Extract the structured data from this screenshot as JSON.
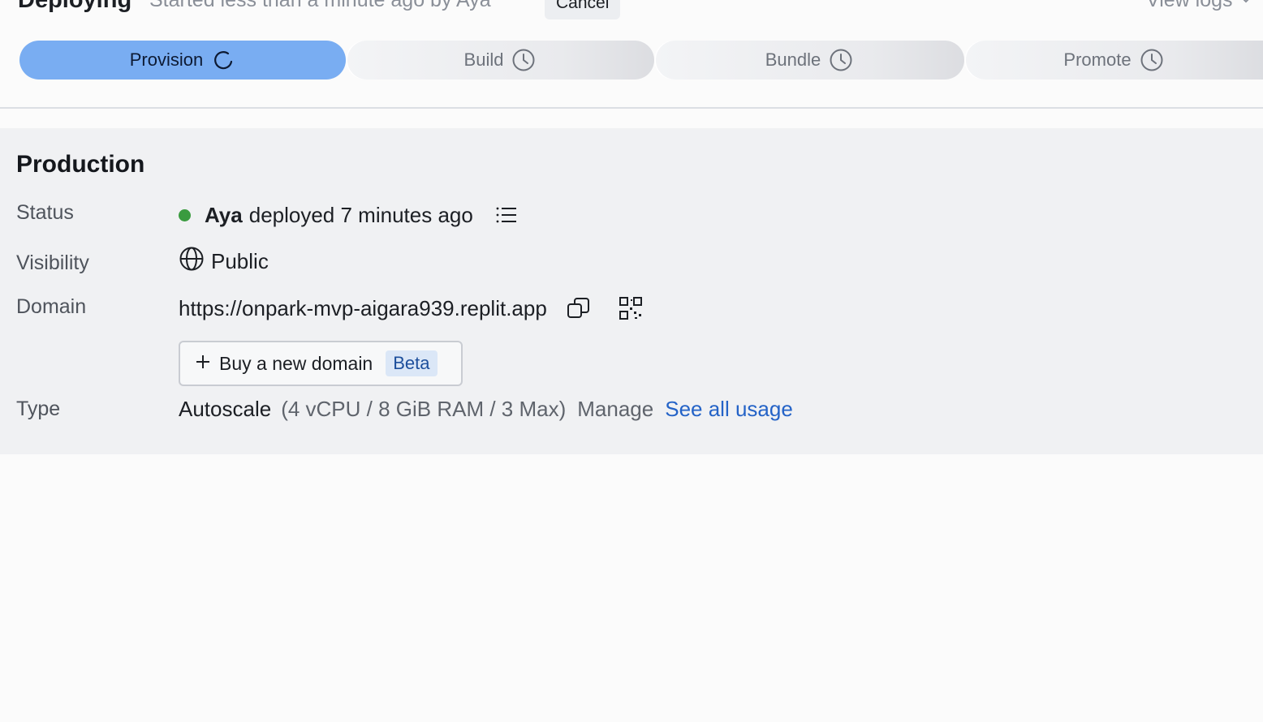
{
  "header": {
    "title": "Deploying",
    "subtitle": "Started less than a minute ago by Aya",
    "cancel_label": "Cancel",
    "view_logs_label": "View logs"
  },
  "steps": [
    {
      "label": "Provision",
      "state": "active",
      "icon": "spinner-icon"
    },
    {
      "label": "Build",
      "state": "pending",
      "icon": "clock-icon"
    },
    {
      "label": "Bundle",
      "state": "pending",
      "icon": "clock-icon"
    },
    {
      "label": "Promote",
      "state": "pending",
      "icon": "clock-icon"
    }
  ],
  "production": {
    "title": "Production",
    "status": {
      "label": "Status",
      "user": "Aya",
      "text": "deployed 7 minutes ago",
      "indicator_color": "#3a9b3f"
    },
    "visibility": {
      "label": "Visibility",
      "value": "Public",
      "icon": "globe-icon"
    },
    "domain": {
      "label": "Domain",
      "url": "https://onpark-mvp-aigara939.replit.app",
      "buy_label": "Buy a new domain",
      "badge": "Beta"
    },
    "type": {
      "label": "Type",
      "value": "Autoscale",
      "specs": "(4 vCPU / 8 GiB RAM / 3 Max)",
      "manage_label": "Manage",
      "usage_link": "See all usage"
    }
  },
  "colors": {
    "active_step": "#79adf2",
    "link": "#2463c7",
    "panel_bg": "#f0f1f3"
  }
}
